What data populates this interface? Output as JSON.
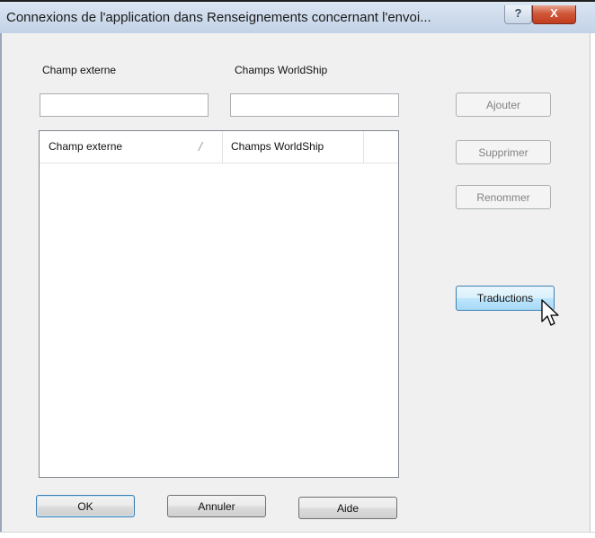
{
  "window": {
    "title": "Connexions de l'application dans Renseignements concernant l'envoi...",
    "help_glyph": "?",
    "close_glyph": "X"
  },
  "form": {
    "external_field_label": "Champ externe",
    "external_field_value": "",
    "worldship_field_label": "Champs WorldShip",
    "worldship_field_value": ""
  },
  "list": {
    "columns": [
      "Champ externe",
      "Champs WorldShip"
    ],
    "sort_glyph": "/",
    "rows": []
  },
  "side_buttons": {
    "add": "Ajouter",
    "delete": "Supprimer",
    "rename": "Renommer",
    "translations": "Traductions"
  },
  "footer_buttons": {
    "ok": "OK",
    "cancel": "Annuler",
    "help": "Aide"
  }
}
